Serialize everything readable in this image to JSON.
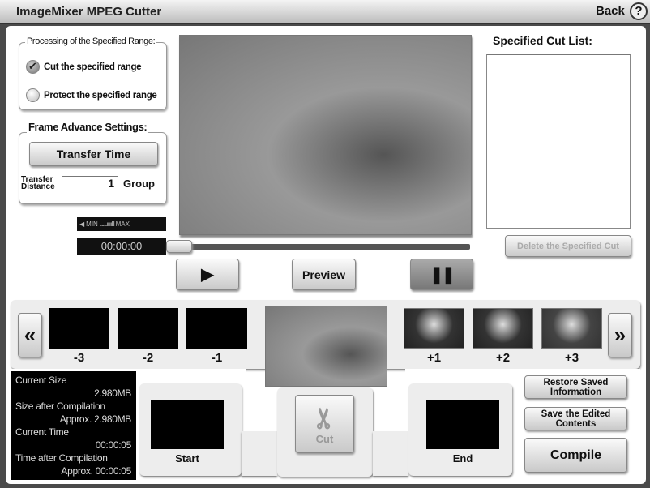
{
  "app": {
    "title": "ImageMixer MPEG Cutter",
    "back_label": "Back",
    "help_label": "?"
  },
  "processing": {
    "label": "Processing of the Specified Range:",
    "options": [
      {
        "label": "Cut the specified range",
        "selected": true
      },
      {
        "label": "Protect the specified range",
        "selected": false
      }
    ]
  },
  "frame_advance": {
    "label": "Frame Advance Settings:",
    "transfer_button": "Transfer Time",
    "distance_label_1": "Transfer",
    "distance_label_2": "Distance",
    "distance_value": "1",
    "unit": "Group"
  },
  "volume": {
    "min_label": "MIN",
    "max_label": "MAX"
  },
  "player": {
    "timecode": "00:00:00",
    "position": 0,
    "preview_label": "Preview",
    "play_icon": "play-icon",
    "pause_icon": "pause-icon"
  },
  "cut_list": {
    "title": "Specified Cut List:",
    "items": [],
    "delete_label": "Delete the Specified Cut"
  },
  "frames": {
    "prev": [
      "-3",
      "-2",
      "-1"
    ],
    "next": [
      "+1",
      "+2",
      "+3"
    ]
  },
  "info": {
    "current_size_label": "Current Size",
    "current_size": "2.980MB",
    "size_after_label": "Size after Compilation",
    "size_after": "Approx. 2.980MB",
    "current_time_label": "Current Time",
    "current_time": "00:00:05",
    "time_after_label": "Time after Compilation",
    "time_after": "Approx. 00:00:05"
  },
  "cut": {
    "start_label": "Start",
    "end_label": "End",
    "cut_label": "Cut"
  },
  "actions": {
    "restore": "Restore Saved Information",
    "save": "Save the Edited Contents",
    "compile": "Compile"
  }
}
